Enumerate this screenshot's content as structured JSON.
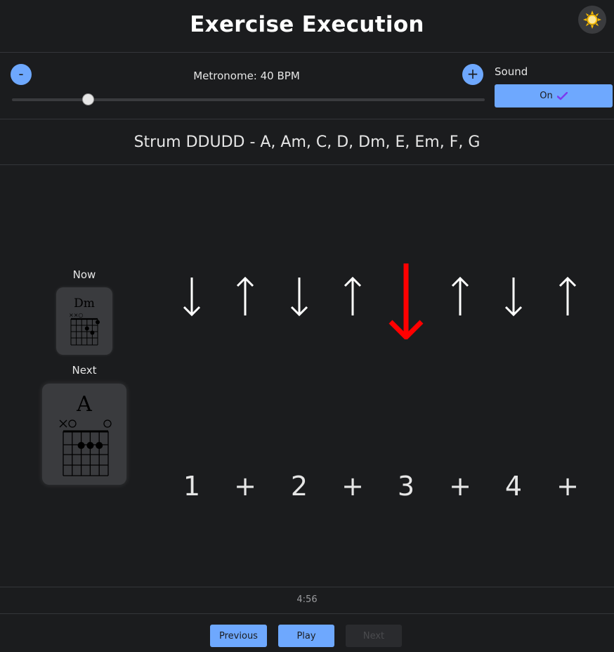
{
  "header": {
    "title": "Exercise Execution",
    "theme_icon": "sun-icon"
  },
  "metronome": {
    "decrease_label": "-",
    "increase_label": "+",
    "label": "Metronome: 40 BPM",
    "bpm_slider_fraction": 0.16
  },
  "sound": {
    "label": "Sound",
    "button_label": "On",
    "button_icon": "check-icon"
  },
  "exercise": {
    "title": "Strum DDUDD - A, Am, C, D, Dm, E, Em, F, G"
  },
  "chords": {
    "now": {
      "label": "Now",
      "name": "Dm"
    },
    "next": {
      "label": "Next",
      "name": "A"
    }
  },
  "strum": {
    "arrows": [
      "down",
      "up",
      "down",
      "up",
      "down",
      "up",
      "down",
      "up"
    ],
    "active_index": 4,
    "counts": [
      "1",
      "+",
      "2",
      "+",
      "3",
      "+",
      "4",
      "+"
    ],
    "active_color": "#ff0000"
  },
  "timer": {
    "value": "4:56"
  },
  "nav": {
    "previous": "Previous",
    "play": "Play",
    "next": "Next"
  },
  "colors": {
    "accent": "#6ea8fe",
    "background": "#1b1c1e"
  }
}
